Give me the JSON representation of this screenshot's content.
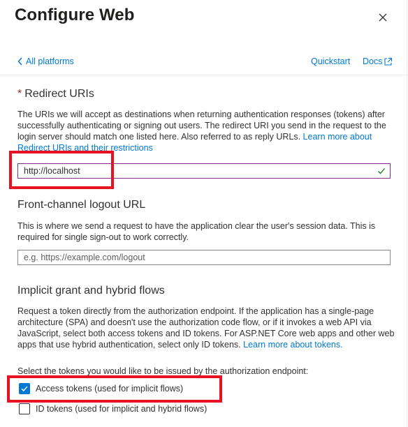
{
  "panel": {
    "title": "Configure Web",
    "close_icon": "close-icon"
  },
  "nav": {
    "back_label": "All platforms",
    "quickstart_label": "Quickstart",
    "docs_label": "Docs"
  },
  "redirect": {
    "required_mark": "*",
    "label": "Redirect URIs",
    "description": "The URIs we will accept as destinations when returning authentication responses (tokens) after successfully authenticating or signing out users. The redirect URI you send in the request to the login server should match one listed here. Also referred to as reply URLs.",
    "link_text": "Learn more about Redirect URIs and their restrictions",
    "value": "http://localhost"
  },
  "logout": {
    "label": "Front-channel logout URL",
    "description": "This is where we send a request to have the application clear the user's session data. This is required for single sign-out to work correctly.",
    "placeholder": "e.g. https://example.com/logout"
  },
  "implicit": {
    "label": "Implicit grant and hybrid flows",
    "description": "Request a token directly from the authorization endpoint. If the application has a single-page architecture (SPA) and doesn't use the authorization code flow, or if it invokes a web API via JavaScript, select both access tokens and ID tokens. For ASP.NET Core web apps and other web apps that use hybrid authentication, select only ID tokens.",
    "link_text": "Learn more about tokens.",
    "select_prompt": "Select the tokens you would like to be issued by the authorization endpoint:",
    "access_tokens_label": "Access tokens (used for implicit flows)",
    "access_tokens_checked": true,
    "id_tokens_label": "ID tokens (used for implicit and hybrid flows)",
    "id_tokens_checked": false
  },
  "colors": {
    "accent": "#0078d4",
    "highlight": "#e81123",
    "required": "#a4262c",
    "valid_check": "#107c10"
  }
}
